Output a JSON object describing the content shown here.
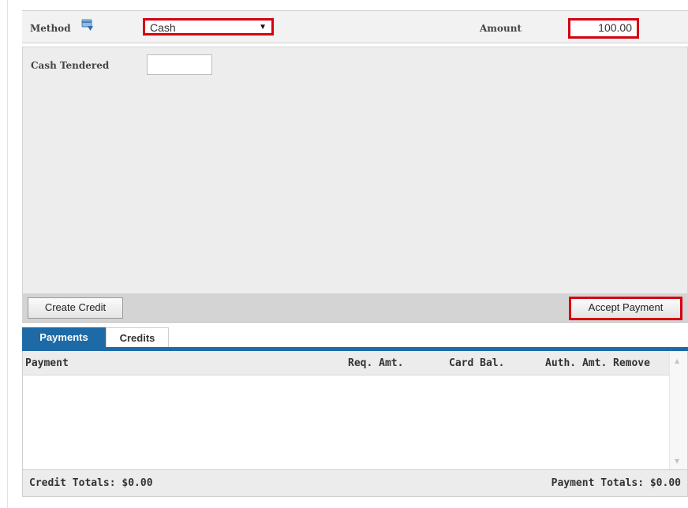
{
  "method_bar": {
    "method_label": "Method",
    "method_value": "Cash",
    "method_dropdown_arrow": "▼",
    "amount_label": "Amount",
    "amount_value": "100.00"
  },
  "cash": {
    "cash_tendered_label": "Cash Tendered",
    "cash_tendered_value": ""
  },
  "actions": {
    "create_credit_label": "Create Credit",
    "accept_payment_label": "Accept Payment"
  },
  "tabs": [
    {
      "label": "Payments",
      "active": true
    },
    {
      "label": "Credits",
      "active": false
    }
  ],
  "grid": {
    "columns": [
      "Payment",
      "Req. Amt.",
      "Card Bal.",
      "Auth. Amt.",
      "Remove"
    ],
    "rows": []
  },
  "totals": {
    "credit_totals": "Credit Totals: $0.00",
    "payment_totals": "Payment Totals: $0.00"
  },
  "colors": {
    "highlight_border": "#d6000f",
    "tab_active": "#1e6aa6"
  },
  "icons": {
    "method": "card-info-icon",
    "scroll_up": "scroll-up-arrow-icon",
    "scroll_down": "scroll-down-arrow-icon"
  }
}
